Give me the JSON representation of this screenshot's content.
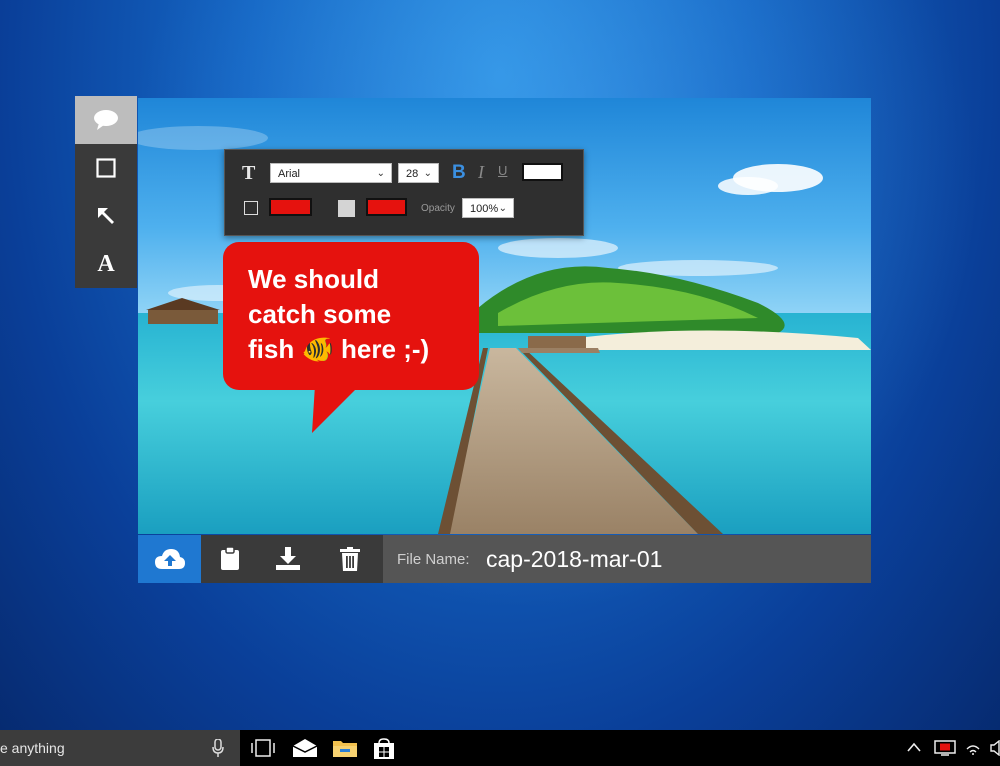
{
  "tools": [
    {
      "name": "speech-bubble",
      "active": true
    },
    {
      "name": "rectangle",
      "active": false
    },
    {
      "name": "arrow",
      "active": false
    },
    {
      "name": "text",
      "label": "A",
      "active": false
    }
  ],
  "format_bar": {
    "text_icon": "T",
    "font": "Arial",
    "font_size": "28",
    "bold": "B",
    "italic": "I",
    "underline": "U",
    "text_color": "#ffffff",
    "border_color": "#e5120e",
    "fill_color": "#e5120e",
    "opacity_label": "Opacity",
    "opacity_value": "100%"
  },
  "bubble": {
    "text": "We should\ncatch some\nfish 🐠 here ;-)",
    "color": "#e5120e"
  },
  "actions": [
    "upload-cloud",
    "clipboard",
    "download",
    "trash"
  ],
  "file": {
    "label": "File Name:",
    "value": "cap-2018-mar-01"
  },
  "taskbar": {
    "search_text": "e anything",
    "pinned": [
      "task-view",
      "mail",
      "file-explorer",
      "store"
    ]
  },
  "accent": "#1f78d1"
}
